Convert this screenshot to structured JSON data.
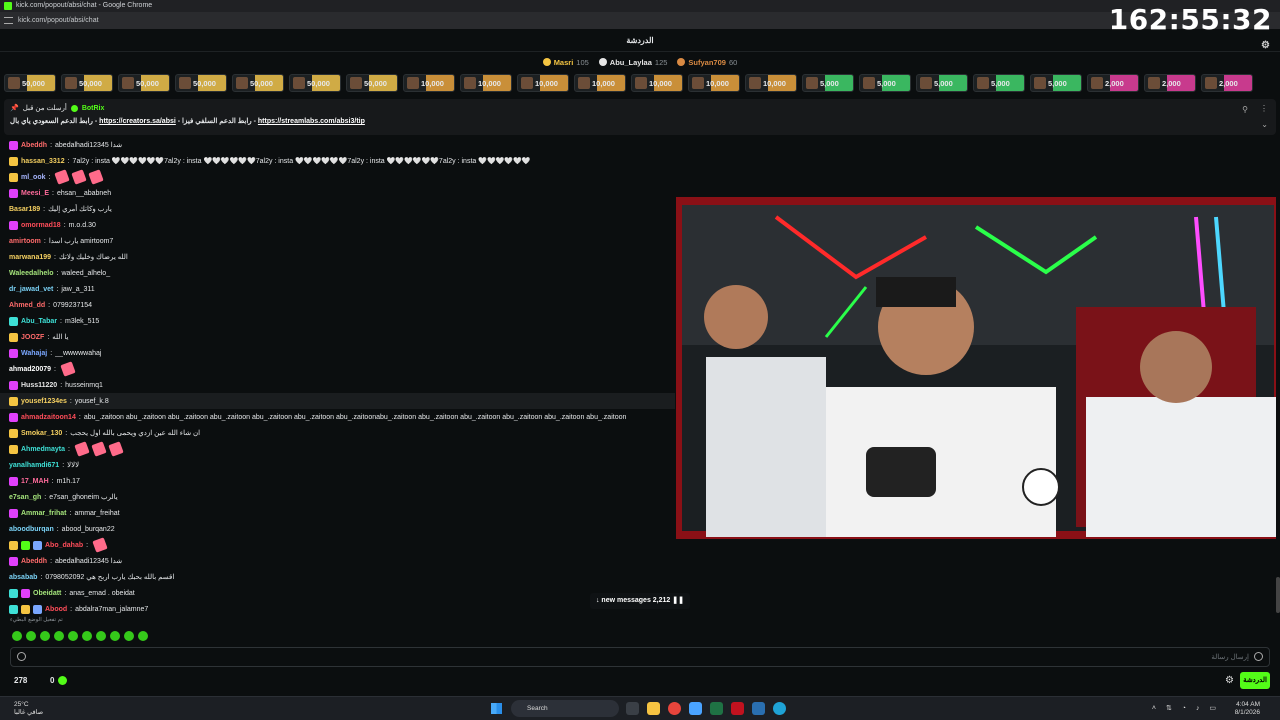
{
  "window": {
    "title": "kick.com/popout/absi/chat - Google Chrome",
    "url": "kick.com/popout/absi/chat",
    "clock": "162:55:32"
  },
  "header": {
    "title": "الدردشة"
  },
  "leaderboard": [
    {
      "name": "Masri",
      "points": "105",
      "color": "#f5c542"
    },
    {
      "name": "Abu_Laylaa",
      "points": "125",
      "color": "#e6e6e6"
    },
    {
      "name": "Sufyan709",
      "points": "60",
      "color": "#d98a43"
    }
  ],
  "gifts": [
    {
      "amount": "50,000",
      "color": "#f0c44b"
    },
    {
      "amount": "50,000",
      "color": "#f0c44b"
    },
    {
      "amount": "50,000",
      "color": "#f0c44b"
    },
    {
      "amount": "50,000",
      "color": "#f0c44b"
    },
    {
      "amount": "50,000",
      "color": "#f0c44b"
    },
    {
      "amount": "50,000",
      "color": "#f0c44b"
    },
    {
      "amount": "50,000",
      "color": "#f0c44b"
    },
    {
      "amount": "10,000",
      "color": "#e8a33d"
    },
    {
      "amount": "10,000",
      "color": "#e8a33d"
    },
    {
      "amount": "10,000",
      "color": "#e8a33d"
    },
    {
      "amount": "10,000",
      "color": "#e8a33d"
    },
    {
      "amount": "10,000",
      "color": "#e8a33d"
    },
    {
      "amount": "10,000",
      "color": "#e8a33d"
    },
    {
      "amount": "10,000",
      "color": "#e8a33d"
    },
    {
      "amount": "5,000",
      "color": "#3fd26b"
    },
    {
      "amount": "5,000",
      "color": "#3fd26b"
    },
    {
      "amount": "5,000",
      "color": "#3fd26b"
    },
    {
      "amount": "5,000",
      "color": "#3fd26b"
    },
    {
      "amount": "5,000",
      "color": "#3fd26b"
    },
    {
      "amount": "2,000",
      "color": "#e63fa0"
    },
    {
      "amount": "2,000",
      "color": "#e63fa0"
    },
    {
      "amount": "2,000",
      "color": "#e63fa0"
    }
  ],
  "pinned": {
    "pinned_by": "أرسلت من قبل",
    "author": "BotRix",
    "label_1": "رابط الدعم السعودي ياي بال -",
    "link_1": "https://creators.sa/absi",
    "label_2": "- رابط الدعم السلفي فيزا -",
    "link_2": "https://streamlabs.com/absi3/tip"
  },
  "messages": [
    {
      "user": "Abeddh",
      "text": "abedalhadi12345 شدا",
      "color": "#ff6b6b",
      "badges": [
        "#e040fb"
      ]
    },
    {
      "user": "hassan_3312",
      "text": "7al2y : insta 🤍🤍🤍🤍🤍🤍7al2y : insta 🤍🤍🤍🤍🤍🤍7al2y : insta 🤍🤍🤍🤍🤍🤍7al2y : insta 🤍🤍🤍🤍🤍🤍7al2y : insta 🤍🤍🤍🤍🤍🤍",
      "color": "#f5d061",
      "badges": [
        "#f5c542"
      ]
    },
    {
      "user": "ml_ook",
      "text": "",
      "color": "#a7b6ff",
      "badges": [
        "#f5c542"
      ],
      "emotes": 3
    },
    {
      "user": "Meesi_E",
      "text": "ehsan__ababneh",
      "color": "#ff6b9b",
      "badges": [
        "#e040fb"
      ]
    },
    {
      "user": "Basar189",
      "text": "يارب وكاتك أمري إليك",
      "color": "#f5d061",
      "badges": []
    },
    {
      "user": "omormad18",
      "text": "m.o.d.30",
      "color": "#ff4d5a",
      "badges": [
        "#e040fb"
      ]
    },
    {
      "user": "amirtoom",
      "text": "يارب اسدا amirtoom7",
      "color": "#ff6b6b",
      "badges": []
    },
    {
      "user": "marwana199",
      "text": "الله يرضاك وخليك ولاتك",
      "color": "#f5d061",
      "badges": []
    },
    {
      "user": "Waleedalhelo",
      "text": "waleed_alhelo_",
      "color": "#a4e37b",
      "badges": []
    },
    {
      "user": "dr_jawad_vet",
      "text": "jaw_a_311",
      "color": "#7bd3f7",
      "badges": []
    },
    {
      "user": "Ahmed_dd",
      "text": "0799237154",
      "color": "#ff6b6b",
      "badges": []
    },
    {
      "user": "Abu_Tabar",
      "text": "m3lek_515",
      "color": "#3ee0d6",
      "badges": [
        "#3ee0d6"
      ]
    },
    {
      "user": "JOOZF",
      "text": "يا الله",
      "color": "#ff6b6b",
      "badges": [
        "#f5c542"
      ]
    },
    {
      "user": "Wahajaj",
      "text": "__wwwwwahaj",
      "color": "#7aa7ff",
      "badges": [
        "#e040fb"
      ]
    },
    {
      "user": "ahmad20079",
      "text": "",
      "color": "#ffffff",
      "badges": [],
      "emotes": 1
    },
    {
      "user": "Huss11220",
      "text": "husseinmq1",
      "color": "#e6e6e6",
      "badges": [
        "#e040fb"
      ]
    },
    {
      "user": "yousef1234es",
      "text": "yousef_k.8",
      "color": "#f5d061",
      "badges": [
        "#f5c542"
      ],
      "highlight": true
    },
    {
      "user": "ahmadzaitoon14",
      "text": "abu_.zaitoon abu_.zaitoon abu_.zaitoon abu_.zaitoon abu_.zaitoon abu_.zaitoon abu_.zaitoonabu_.zaitoon abu_.zaitoon abu_.zaitoon abu_.zaitoon abu_.zaitoon abu_.zaitoon",
      "color": "#ff4d5a",
      "badges": [
        "#e040fb"
      ]
    },
    {
      "user": "Smokar_130",
      "text": "ان شاء الله عين ازدي ويحمى بالله اول يحجب",
      "color": "#f5d061",
      "badges": [
        "#f5c542"
      ]
    },
    {
      "user": "Ahmedmayta",
      "text": "",
      "color": "#3ee0d6",
      "badges": [
        "#f5c542"
      ],
      "emotes": 3
    },
    {
      "user": "yanalhamdi671",
      "text": "لالالا",
      "color": "#3ee0d6",
      "badges": []
    },
    {
      "user": "17_MAH",
      "text": "m1h.17",
      "color": "#ff6b9b",
      "badges": [
        "#e040fb"
      ]
    },
    {
      "user": "e7san_gh",
      "text": "e7san_ghoneim يالرب",
      "color": "#a4e37b",
      "badges": []
    },
    {
      "user": "Ammar_frihat",
      "text": "ammar_freihat",
      "color": "#a4e37b",
      "badges": [
        "#e040fb"
      ]
    },
    {
      "user": "aboodburqan",
      "text": "abood_burqan22",
      "color": "#7bd3f7",
      "badges": []
    },
    {
      "user": "Abo_dahab",
      "text": "",
      "color": "#ff4d5a",
      "badges": [
        "#f5c542",
        "#53fc18",
        "#7aa7ff"
      ],
      "emotes": 1
    },
    {
      "user": "Abeddh",
      "text": "abedalhadi12345 شدا",
      "color": "#ff6b6b",
      "badges": [
        "#e040fb"
      ]
    },
    {
      "user": "absabab",
      "text": "0798052092 اقسم بالله بحبك يارب اربح هي",
      "color": "#7bd3f7",
      "badges": []
    },
    {
      "user": "Obeidatt",
      "text": "anas_emad . obeidat",
      "color": "#a4e37b",
      "badges": [
        "#3ee0d6",
        "#e040fb"
      ]
    },
    {
      "user": "Abood",
      "text": "abdalra7man_jalamne7",
      "color": "#ff4d5a",
      "badges": [
        "#3ee0d6",
        "#f5c542",
        "#7aa7ff"
      ]
    }
  ],
  "new_messages": "↓ new messages 2,212",
  "pause_icon": "pause-icon",
  "emote_hint": "تم تفعيل الوضع البطيء",
  "input": {
    "placeholder": "إرسال رسالة"
  },
  "footer": {
    "viewers": "278",
    "zero": "0",
    "chat_button": "الدردشة"
  },
  "taskbar": {
    "temp": "25°C",
    "weather": "صافي غالبا",
    "search": "Search",
    "time": "4:04 AM",
    "date": "8/1/2026"
  }
}
